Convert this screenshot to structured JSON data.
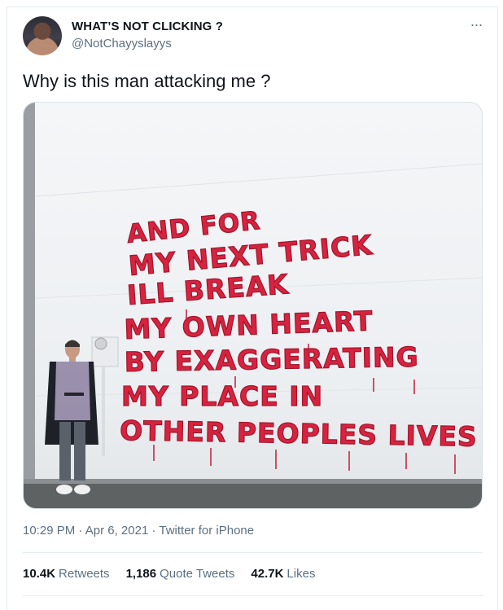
{
  "tweet": {
    "display_name": "WHAT’S NOT CLICKING ?",
    "handle": "@NotChayyslayys",
    "more_icon": "···",
    "text": "Why is this man attacking me ?",
    "time": "10:29 PM",
    "separator1": "·",
    "date": "Apr 6, 2021",
    "separator2": "·",
    "source": "Twitter for iPhone"
  },
  "media": {
    "balloon_lines": [
      "AND FOR",
      "MY NEXT TRICK",
      "ILL BREAK",
      "MY OWN HEART",
      "BY EXAGGERATING",
      "MY PLACE IN",
      "OTHER PEOPLES LIVES"
    ],
    "balloon_color": "#d6233f"
  },
  "stats": {
    "retweets_count": "10.4K",
    "retweets_label": "Retweets",
    "quotes_count": "1,186",
    "quotes_label": "Quote Tweets",
    "likes_count": "42.7K",
    "likes_label": "Likes"
  }
}
